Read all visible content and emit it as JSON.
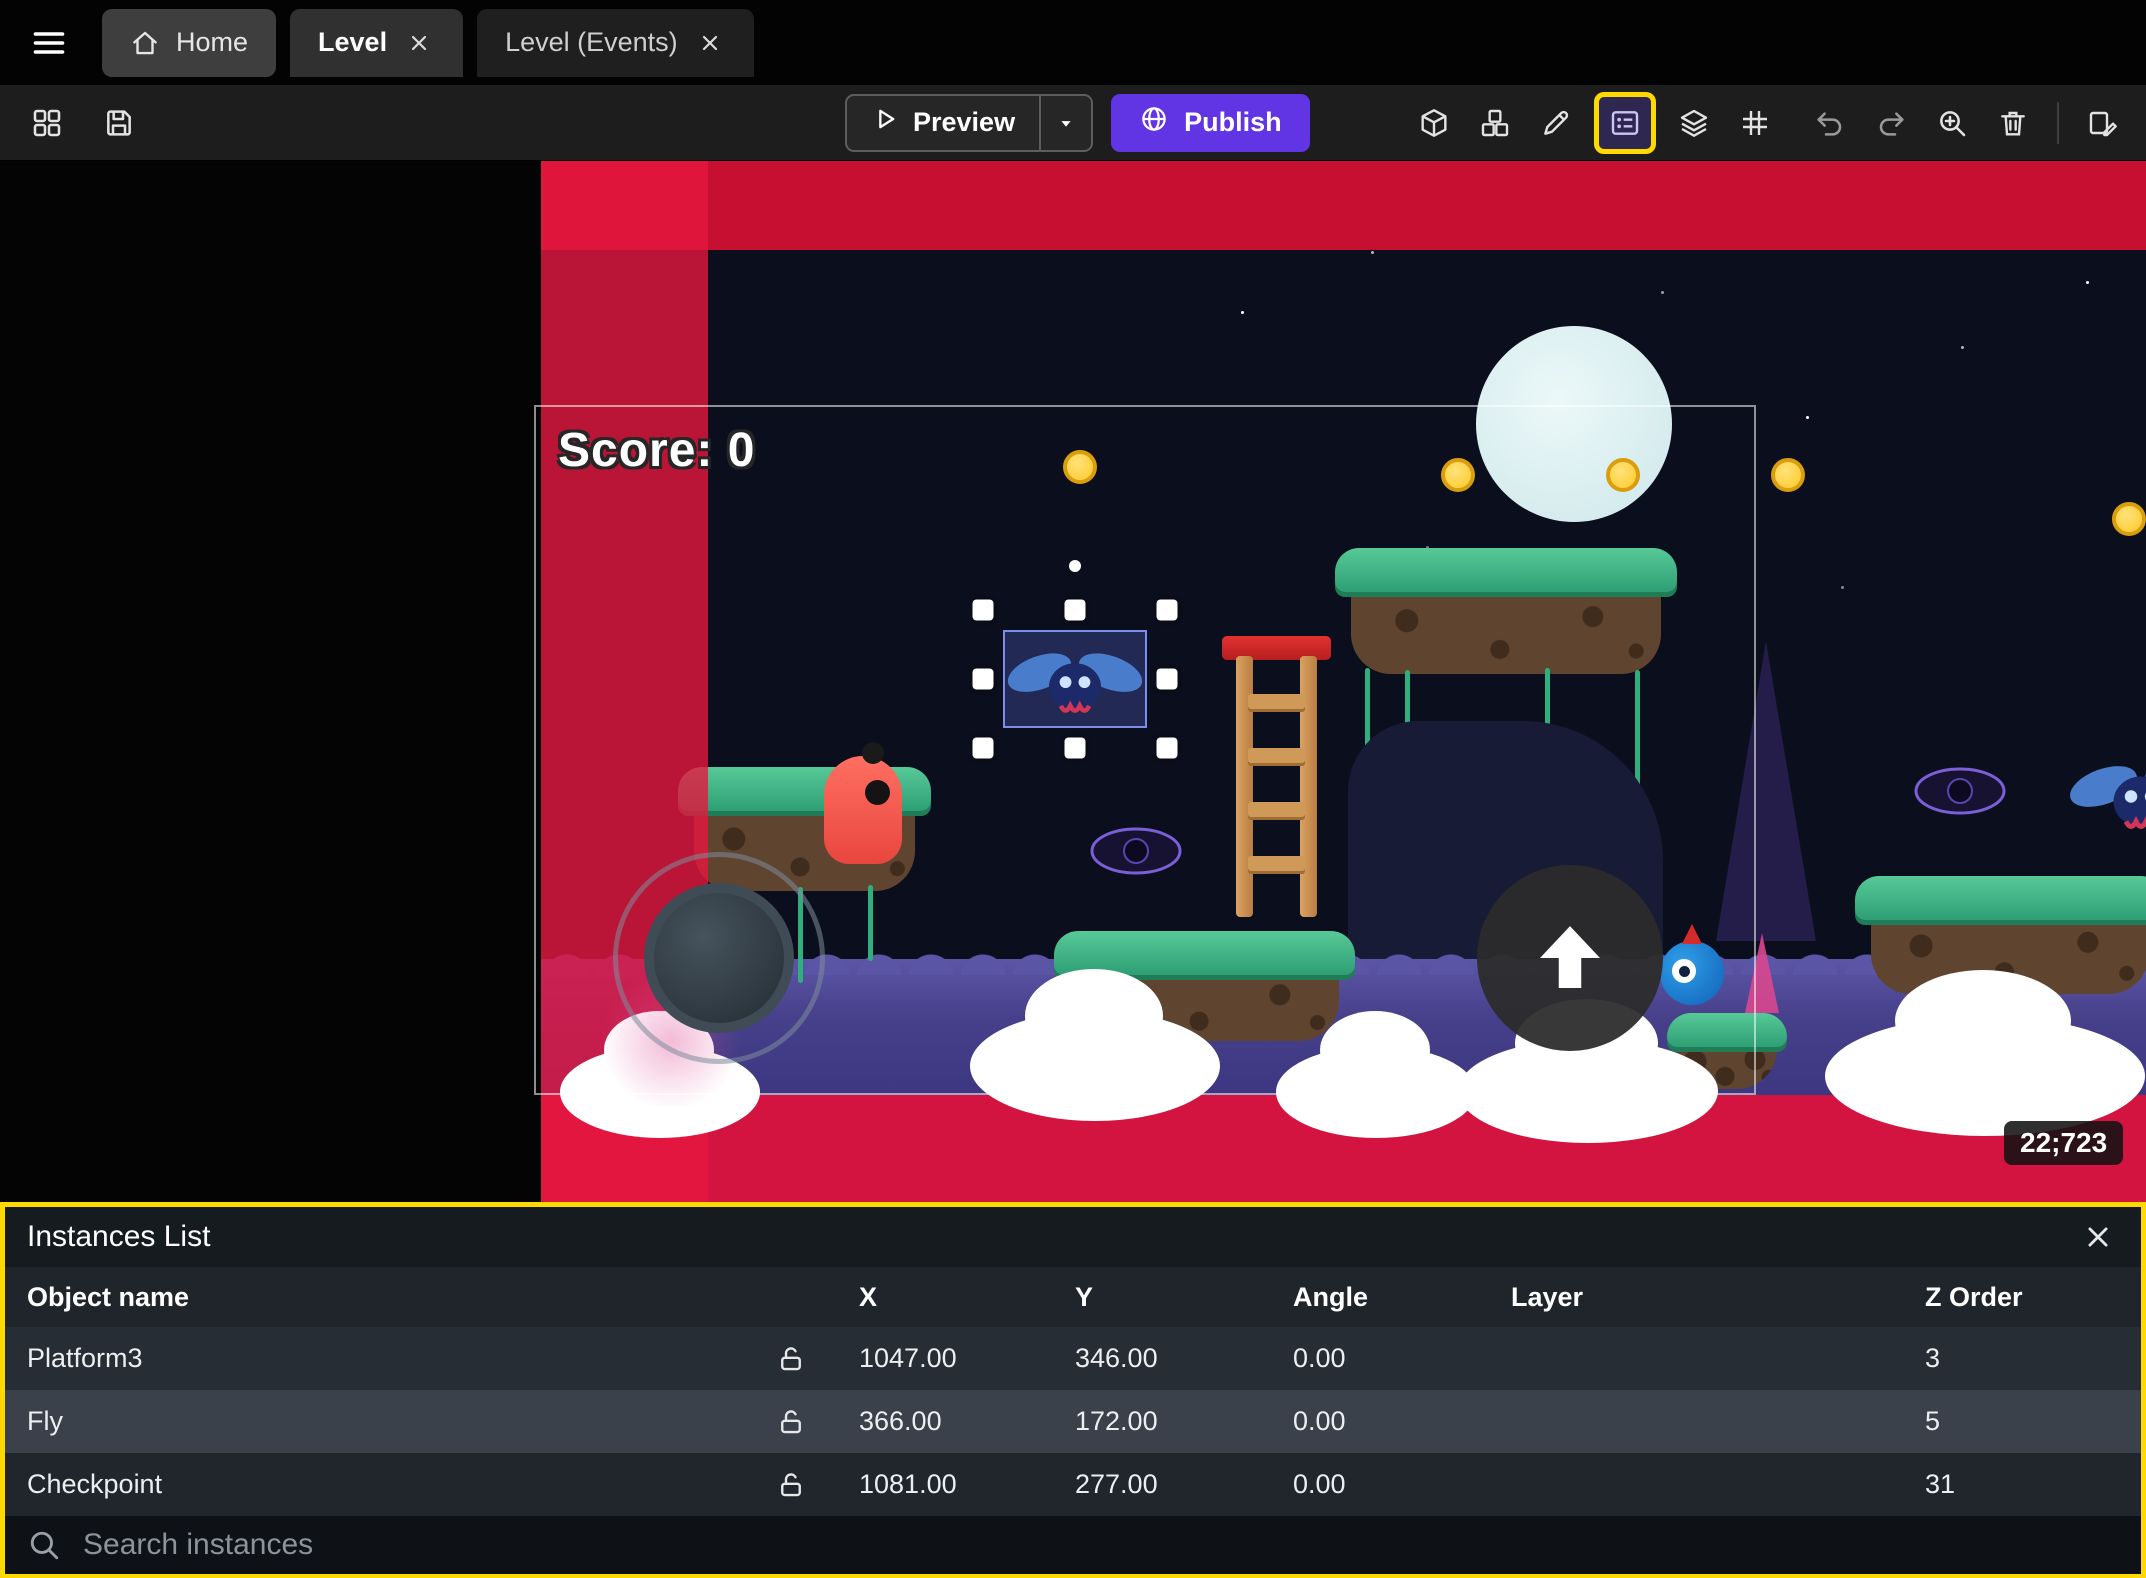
{
  "colors": {
    "publish_button": "#6135e4",
    "highlight_yellow": "#ffd900",
    "red_zone": "#d41440",
    "selection_blue": "#8ca0ff"
  },
  "tabbar": {
    "tabs": [
      {
        "label": "Home"
      },
      {
        "label": "Level"
      },
      {
        "label": "Level (Events)"
      }
    ]
  },
  "toolbar": {
    "preview_label": "Preview",
    "publish_label": "Publish",
    "left_icons": [
      "panels-icon",
      "save-icon"
    ],
    "right_icons": [
      "objects-3d-box-icon",
      "object-groups-icon",
      "edit-pencil-icon",
      "instances-list-icon",
      "layers-icon",
      "grid-icon",
      "undo-icon",
      "redo-icon",
      "zoom-in-icon",
      "trash-icon",
      "edit-properties-icon"
    ],
    "highlighted_icon": "instances-list-icon"
  },
  "scene": {
    "score_text": "Score: 0",
    "coordinates_badge": "22;723",
    "selected_object": "Fly"
  },
  "instances_panel": {
    "title": "Instances List",
    "columns": [
      "Object name",
      "X",
      "Y",
      "Angle",
      "Layer",
      "Z Order"
    ],
    "rows": [
      {
        "name": "Platform3",
        "x": "1047.00",
        "y": "346.00",
        "angle": "0.00",
        "layer": "",
        "z_order": "3",
        "locked": false
      },
      {
        "name": "Fly",
        "x": "366.00",
        "y": "172.00",
        "angle": "0.00",
        "layer": "",
        "z_order": "5",
        "locked": false,
        "selected": true
      },
      {
        "name": "Checkpoint",
        "x": "1081.00",
        "y": "277.00",
        "angle": "0.00",
        "layer": "",
        "z_order": "31",
        "locked": false
      }
    ],
    "search_placeholder": "Search instances"
  }
}
